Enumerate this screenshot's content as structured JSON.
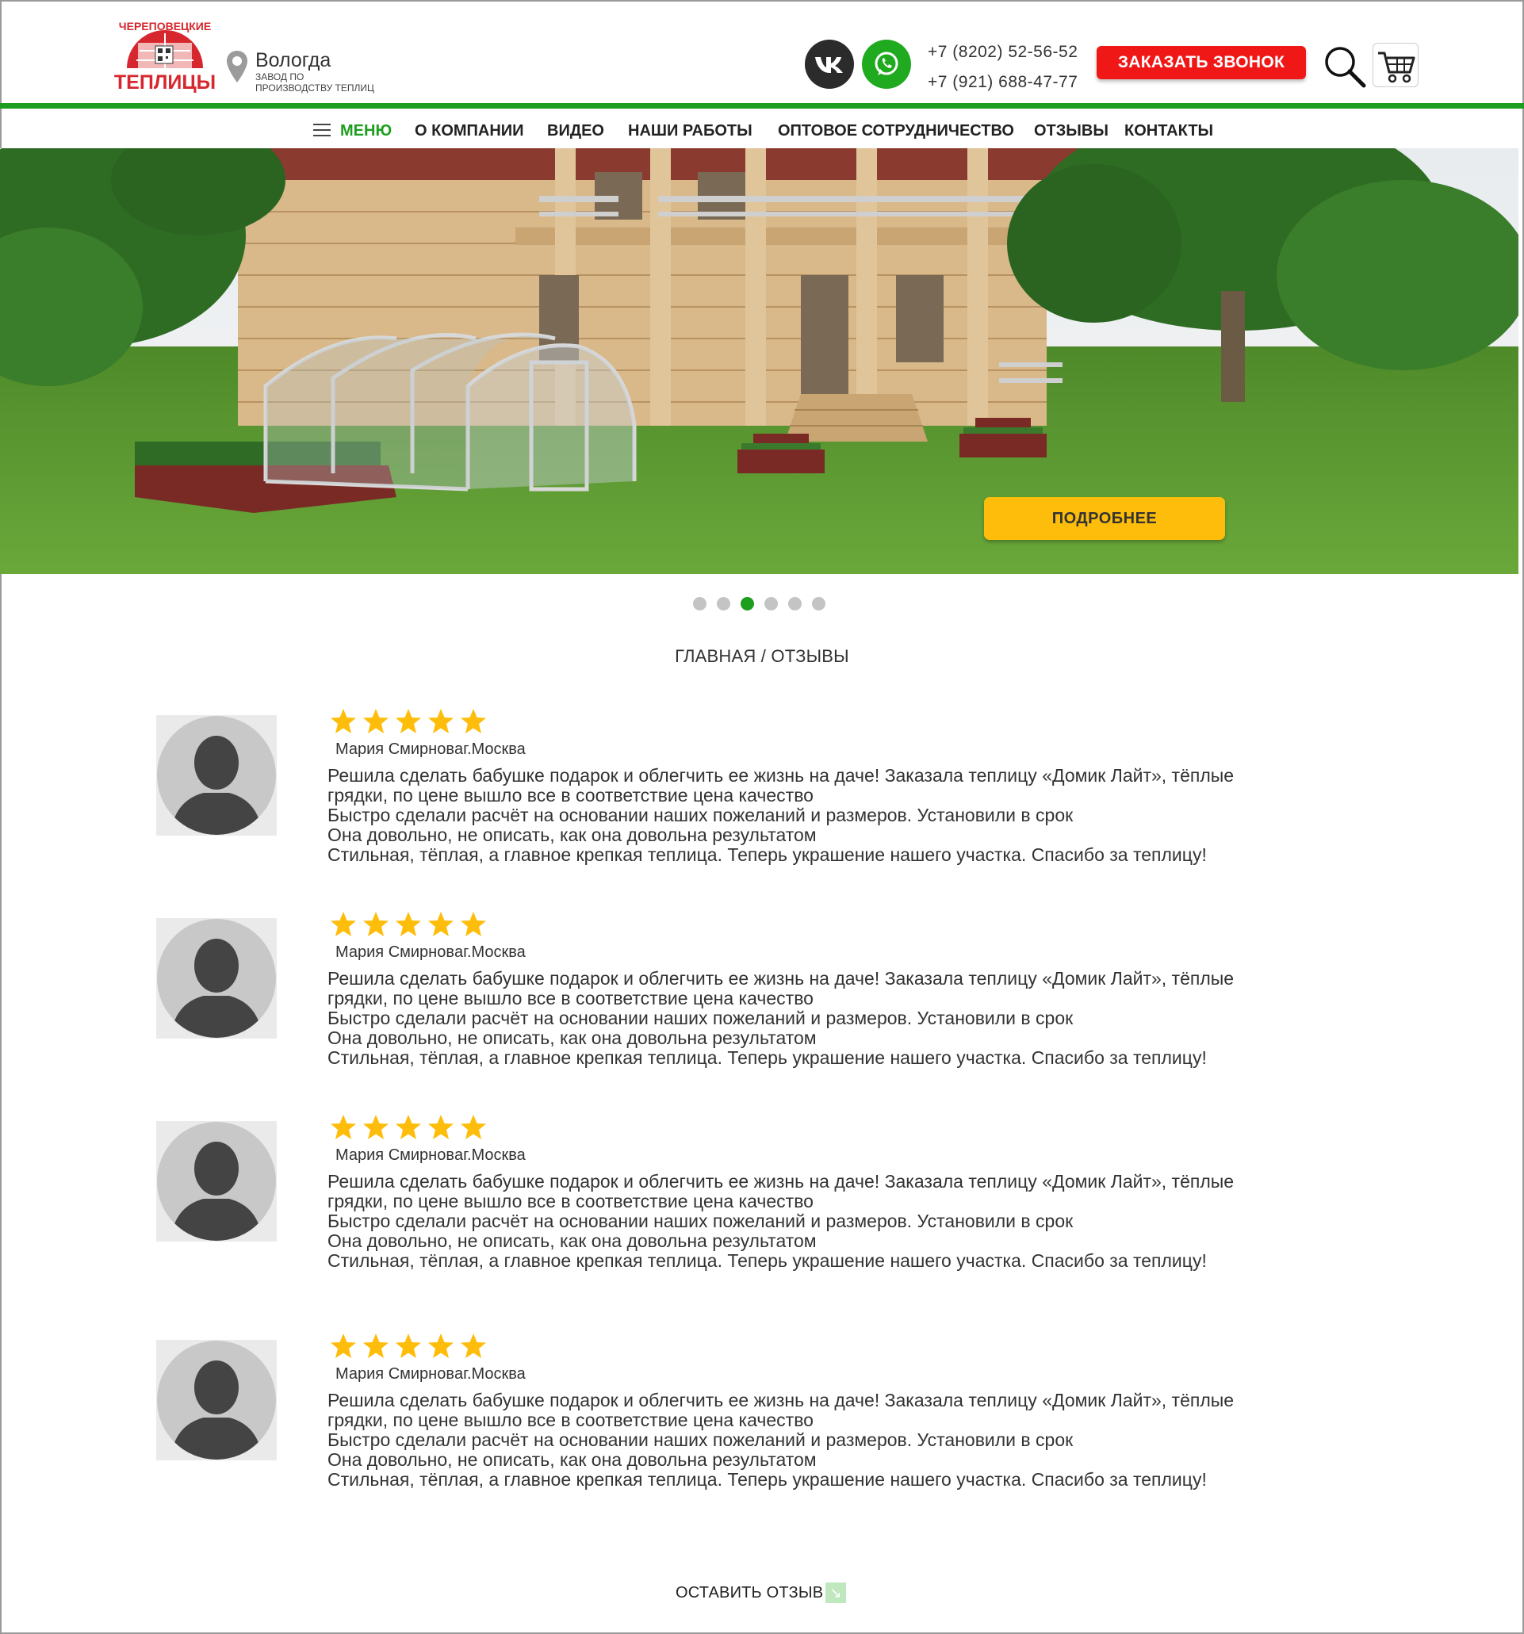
{
  "header": {
    "logo_top": "ЧЕРЕПОВЕЦКИЕ",
    "logo_bottom": "ТЕПЛИЦЫ",
    "city": "Вологда",
    "city_subtitle": "завод по производству теплиц",
    "phone1": "+7 (8202) 52-56-52",
    "phone2": "+7 (921) 688-47-77",
    "call_button": "ЗАКАЗАТЬ ЗВОНОК",
    "icons": {
      "vk": "vk-icon",
      "whatsapp": "whatsapp-icon",
      "search": "search-icon",
      "cart": "cart-icon",
      "location": "location-pin-icon"
    },
    "accent_color": "#1e9e1e",
    "call_button_color": "#f01717"
  },
  "nav": {
    "menu": "МЕНЮ",
    "items": [
      "О КОМПАНИИ",
      "ВИДЕО",
      "НАШИ РАБОТЫ",
      "ОПТОВОЕ СОТРУДНИЧЕСТВО",
      "ОТЗЫВЫ",
      "КОНТАКТЫ"
    ]
  },
  "hero": {
    "button": "ПОДРОБНЕЕ",
    "button_color": "#fdbd0a",
    "slides_count": 6,
    "active_slide": 3
  },
  "breadcrumb": "ГЛАВНАЯ / ОТЗЫВЫ",
  "reviews": [
    {
      "rating": 5,
      "author": "Мария Смирновa",
      "city": "г.Москва",
      "lines": [
        "Решила сделать бабушке подарок и облегчить ее жизнь на даче! Заказала теплицу «Домик Лайт», тёплые",
        "грядки, по цене вышло все в соответствие цена качество",
        "Быстро сделали расчёт на основании наших пожеланий и размеров. Установили в срок",
        "Она довольно, не описать, как она довольна результатом",
        "Стильная, тёплая, а главное крепкая теплица. Теперь украшение нашего участка. Спасибо за теплицу!"
      ]
    },
    {
      "rating": 5,
      "author": "Мария Смирновa",
      "city": "г.Москва",
      "lines": [
        "Решила сделать бабушке подарок и облегчить ее жизнь на даче! Заказала теплицу «Домик Лайт», тёплые",
        "грядки, по цене вышло все в соответствие цена качество",
        "Быстро сделали расчёт на основании наших пожеланий и размеров. Установили в срок",
        "Она довольно, не описать, как она довольна результатом",
        "Стильная, тёплая, а главное крепкая теплица. Теперь украшение нашего участка. Спасибо за теплицу!"
      ]
    },
    {
      "rating": 5,
      "author": "Мария Смирновa",
      "city": "г.Москва",
      "lines": [
        "Решила сделать бабушке подарок и облегчить ее жизнь на даче! Заказала теплицу «Домик Лайт», тёплые",
        "грядки, по цене вышло все в соответствие цена качество",
        "Быстро сделали расчёт на основании наших пожеланий и размеров. Установили в срок",
        "Она довольно, не описать, как она довольна результатом",
        "Стильная, тёплая, а главное крепкая теплица. Теперь украшение нашего участка. Спасибо за теплицу!"
      ]
    },
    {
      "rating": 5,
      "author": "Мария Смирновa",
      "city": "г.Москва",
      "lines": [
        "Решила сделать бабушке подарок и облегчить ее жизнь на даче! Заказала теплицу «Домик Лайт», тёплые",
        "грядки, по цене вышло все в соответствие цена качество",
        "Быстро сделали расчёт на основании наших пожеланий и размеров. Установили в срок",
        "Она довольно, не описать, как она довольна результатом",
        "Стильная, тёплая, а главное крепкая теплица. Теперь украшение нашего участка. Спасибо за теплицу!"
      ]
    }
  ],
  "leave_review": "ОСТАВИТЬ ОТЗЫВ",
  "star_color": "#fdbd0a"
}
